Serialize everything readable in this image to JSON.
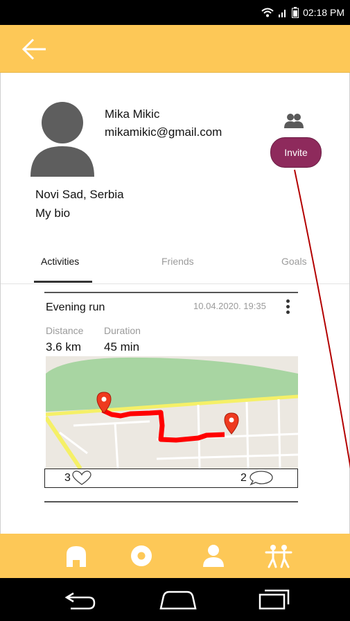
{
  "status_bar": {
    "time": "02:18 PM"
  },
  "profile": {
    "name": "Mika Mikic",
    "email": "mikamikic@gmail.com",
    "location": "Novi Sad, Serbia",
    "bio": "My bio",
    "invite_label": "Invite"
  },
  "tabs": [
    {
      "label": "Activities",
      "active": true
    },
    {
      "label": "Friends",
      "active": false
    },
    {
      "label": "Goals",
      "active": false
    }
  ],
  "activity": {
    "title": "Evening run",
    "date": "10.04.2020. 19:35",
    "distance_label": "Distance",
    "duration_label": "Duration",
    "distance": "3.6 km",
    "duration": "45 min",
    "likes": "3",
    "comments": "2"
  },
  "bottom_nav": {
    "items": [
      "home-icon",
      "record-icon",
      "profile-icon",
      "people-icon"
    ],
    "active": "profile-icon"
  },
  "colors": {
    "accent_yellow": "#fdc857",
    "invite_button": "#8e2a5c",
    "route": "#ff0000",
    "map_park": "#a8d5a2",
    "map_ground": "#ece8e1"
  }
}
